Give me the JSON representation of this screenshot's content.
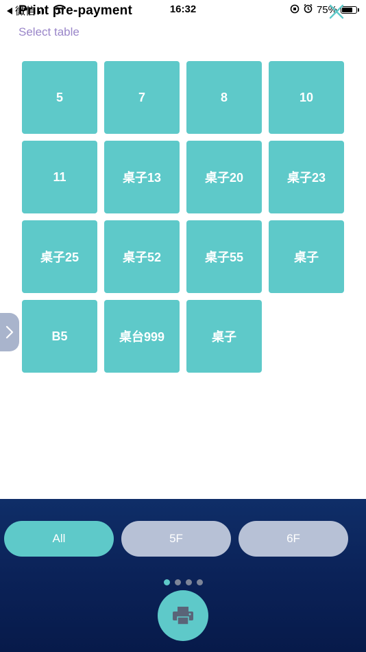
{
  "status_bar": {
    "carrier": "微信",
    "time": "16:32",
    "battery_percent": "75%",
    "battery_level": 0.75
  },
  "header": {
    "title": "Print pre-payment",
    "subtitle": "Select table"
  },
  "tables": [
    "5",
    "7",
    "8",
    "10",
    "11",
    "桌子13",
    "桌子20",
    "桌子23",
    "桌子25",
    "桌子52",
    "桌子55",
    "桌子",
    "B5",
    "桌台999",
    "桌子"
  ],
  "floor_tabs": [
    {
      "label": "All",
      "active": true
    },
    {
      "label": "5F",
      "active": false
    },
    {
      "label": "6F",
      "active": false
    }
  ],
  "pager": {
    "count": 4,
    "active_index": 0
  },
  "colors": {
    "accent": "#5ec9c9",
    "subtitle": "#9a86c9",
    "panel": "#0b2258",
    "inactive_tab": "#b7c1d6"
  },
  "icons": {
    "close": "close-icon",
    "drawer": "chevron-right-icon",
    "print": "printer-icon"
  }
}
